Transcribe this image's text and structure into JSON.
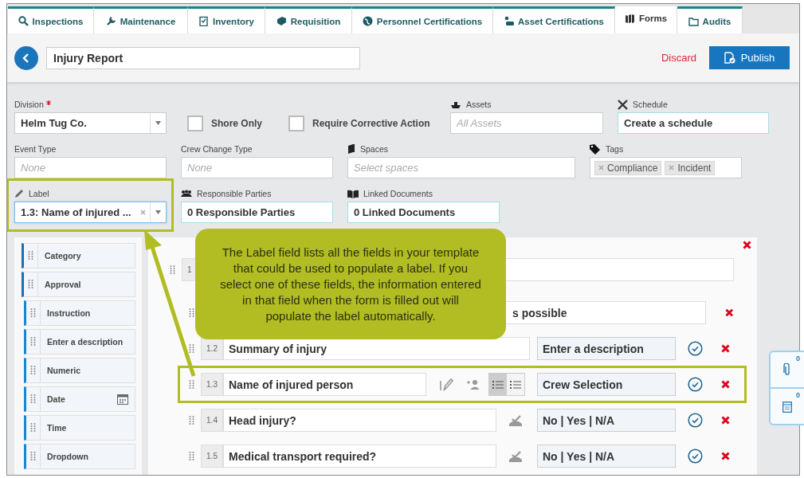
{
  "tabs": [
    {
      "label": "Inspections",
      "selected": false
    },
    {
      "label": "Maintenance",
      "selected": false
    },
    {
      "label": "Inventory",
      "selected": false
    },
    {
      "label": "Requisition",
      "selected": false
    },
    {
      "label": "Personnel Certifications",
      "selected": false
    },
    {
      "label": "Asset Certifications",
      "selected": false
    },
    {
      "label": "Forms",
      "selected": true
    },
    {
      "label": "Audits",
      "selected": false
    }
  ],
  "header": {
    "title": "Injury Report",
    "discard": "Discard",
    "publish": "Publish"
  },
  "fields": [
    [
      {
        "kind": "select",
        "label": "Division",
        "required": true,
        "value": "Helm Tug Co.",
        "highlighted": false
      },
      {
        "kind": "checkbox",
        "label": "Shore Only",
        "checked": false
      },
      {
        "kind": "checkbox",
        "label": "Require Corrective Action",
        "checked": false
      },
      {
        "kind": "input",
        "label": "Assets",
        "placeholder": "All Assets",
        "highlighted": false
      },
      {
        "kind": "link",
        "label": "Schedule",
        "value": "Create a schedule",
        "highlighted": false
      }
    ],
    [
      {
        "kind": "input",
        "label": "Event Type",
        "placeholder": "None",
        "highlighted": false
      },
      {
        "kind": "input",
        "label": "Crew Change Type",
        "placeholder": "None",
        "highlighted": false
      },
      {
        "kind": "input",
        "label": "Spaces",
        "placeholder": "Select spaces",
        "highlighted": false
      },
      {
        "kind": "tags",
        "label": "Tags",
        "tags": [
          "Compliance",
          "Incident"
        ],
        "highlighted": false
      }
    ],
    [
      {
        "kind": "select",
        "label": "Label",
        "value": "1.3: Name of injured ...",
        "clearable": true,
        "highlighted": true
      },
      {
        "kind": "link",
        "label": "Responsible Parties",
        "value": "0 Responsible Parties",
        "highlighted": false
      },
      {
        "kind": "link",
        "label": "Linked Documents",
        "value": "0 Linked Documents",
        "highlighted": false
      }
    ]
  ],
  "palette": [
    {
      "kind": "section",
      "label": "Category"
    },
    {
      "kind": "section",
      "label": "Approval"
    },
    {
      "kind": "field",
      "label": "Instruction"
    },
    {
      "kind": "field",
      "label": "Enter a description"
    },
    {
      "kind": "field",
      "label": "Numeric"
    },
    {
      "kind": "date",
      "label": "Date"
    },
    {
      "kind": "field",
      "label": "Time"
    },
    {
      "kind": "field",
      "label": "Dropdown"
    }
  ],
  "builder": [
    {
      "kind": "section",
      "number": "1"
    },
    {
      "kind": "partial",
      "text": "s possible",
      "highlighted": false
    },
    {
      "kind": "text",
      "number": "1.2",
      "text": "Summary of injury",
      "type": "Enter a description",
      "highlighted": false
    },
    {
      "kind": "selection",
      "number": "1.3",
      "text": "Name of injured person",
      "type": "Crew Selection",
      "highlighted": true,
      "toggle": [
        {
          "selected": true
        },
        {
          "selected": false
        }
      ]
    },
    {
      "kind": "yesno",
      "number": "1.4",
      "text": "Head injury?",
      "type": "No | Yes | N/A",
      "highlighted": false
    },
    {
      "kind": "yesno",
      "number": "1.5",
      "text": "Medical transport required?",
      "type": "No | Yes | N/A",
      "highlighted": false
    }
  ],
  "callout": {
    "text": "The Label field lists all the fields in your template that could be used to populate a label. If you select one of these fields, the information entered in that field when the form is filled out will populate the label automatically."
  },
  "side_tabs": [
    {
      "count": "0"
    },
    {
      "count": "0"
    }
  ]
}
